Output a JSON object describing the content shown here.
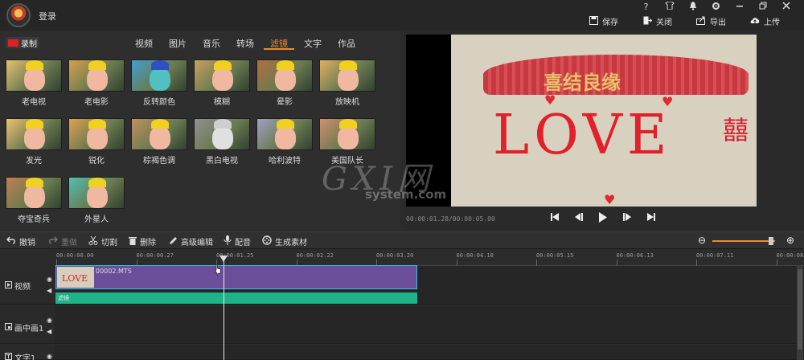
{
  "topbar": {
    "login": "登录",
    "window_controls": [
      "?",
      "shirt-icon",
      "bell-icon",
      "gear-icon",
      "minimize-icon",
      "maximize-icon",
      "close-icon"
    ],
    "actions": [
      {
        "icon": "save-icon",
        "label": "保存"
      },
      {
        "icon": "exit-icon",
        "label": "关闭"
      },
      {
        "icon": "export-icon",
        "label": "导出"
      },
      {
        "icon": "upload-icon",
        "label": "上传"
      }
    ]
  },
  "library": {
    "record_label": "录制",
    "tabs": [
      "视频",
      "图片",
      "音乐",
      "转场",
      "滤镜",
      "文字",
      "作品"
    ],
    "active_tab": "滤镜",
    "filters": [
      {
        "name": "老电视",
        "tint": "#e8c070"
      },
      {
        "name": "老电影",
        "tint": "#d8a050"
      },
      {
        "name": "反转颜色",
        "tint": "#40a0d0"
      },
      {
        "name": "模糊",
        "tint": "#c8a060"
      },
      {
        "name": "晕影",
        "tint": "#b07040"
      },
      {
        "name": "放映机",
        "tint": "#e0b060"
      },
      {
        "name": "发光",
        "tint": "#f0c070"
      },
      {
        "name": "锐化",
        "tint": "#e0a050"
      },
      {
        "name": "棕褐色调",
        "tint": "#c09060"
      },
      {
        "name": "黑白电视",
        "tint": "#909090"
      },
      {
        "name": "哈利波特",
        "tint": "#a0a0c0"
      },
      {
        "name": "美国队长",
        "tint": "#d09070"
      },
      {
        "name": "夺宝奇兵",
        "tint": "#c08050"
      },
      {
        "name": "外星人",
        "tint": "#50c0b0"
      }
    ]
  },
  "preview": {
    "banner_text": "喜结良缘",
    "love_text": "LOVE",
    "xi_char": "囍",
    "timecode": "00:00:01.28/00:00:05.00",
    "controls": [
      "skip-start-icon",
      "step-back-icon",
      "play-icon",
      "step-forward-icon",
      "skip-end-icon"
    ]
  },
  "watermark": {
    "main": "GXI网",
    "sub": "system.com"
  },
  "toolbar": {
    "undo": "撤销",
    "redo": "重做",
    "cut": "切割",
    "delete": "删除",
    "advanced_edit": "高级编辑",
    "dub": "配音",
    "generate": "生成素材",
    "zoom_level": 0.9
  },
  "timeline": {
    "ticks": [
      "00:00:00.00",
      "00:00:00.27",
      "00:00:01.25",
      "00:00:02.22",
      "00:00:03.20",
      "00:00:04.18",
      "00:00:05.15",
      "00:00:06.13",
      "00:00:07.11",
      "00:00:08.0"
    ],
    "tracks": [
      "视频",
      "画中画1",
      "文字1"
    ],
    "clip_name": "00002.MTS",
    "clip_thumb_text": "LOVE",
    "fx_label": "滤镜"
  },
  "colors": {
    "accent": "#f08a2a",
    "clip": "#6a4e9a",
    "clip_border": "#2fc7e6",
    "fx_bar": "#1fb388"
  }
}
